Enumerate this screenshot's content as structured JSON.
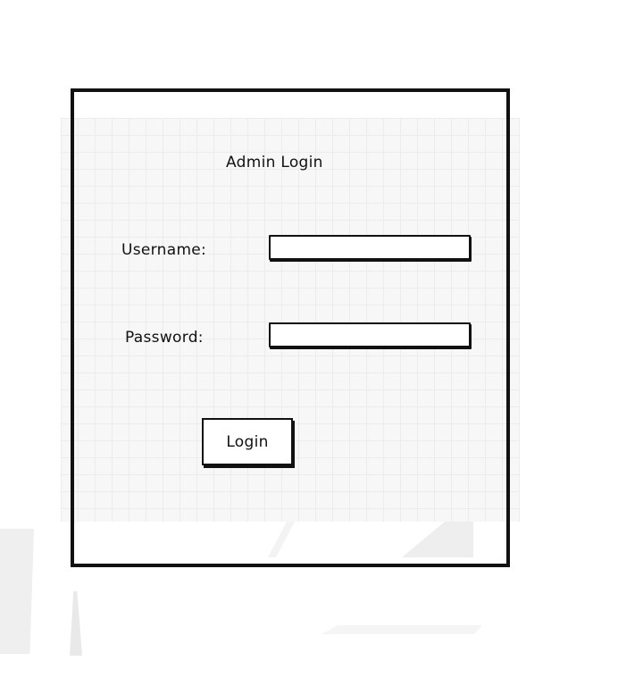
{
  "login": {
    "title": "Admin Login",
    "username_label": "Username:",
    "username_value": "",
    "password_label": "Password:",
    "password_value": "",
    "submit_label": "Login"
  },
  "colors": {
    "stroke": "#111111",
    "grid_background": "#f7f7f7",
    "grid_line": "#ececec"
  }
}
